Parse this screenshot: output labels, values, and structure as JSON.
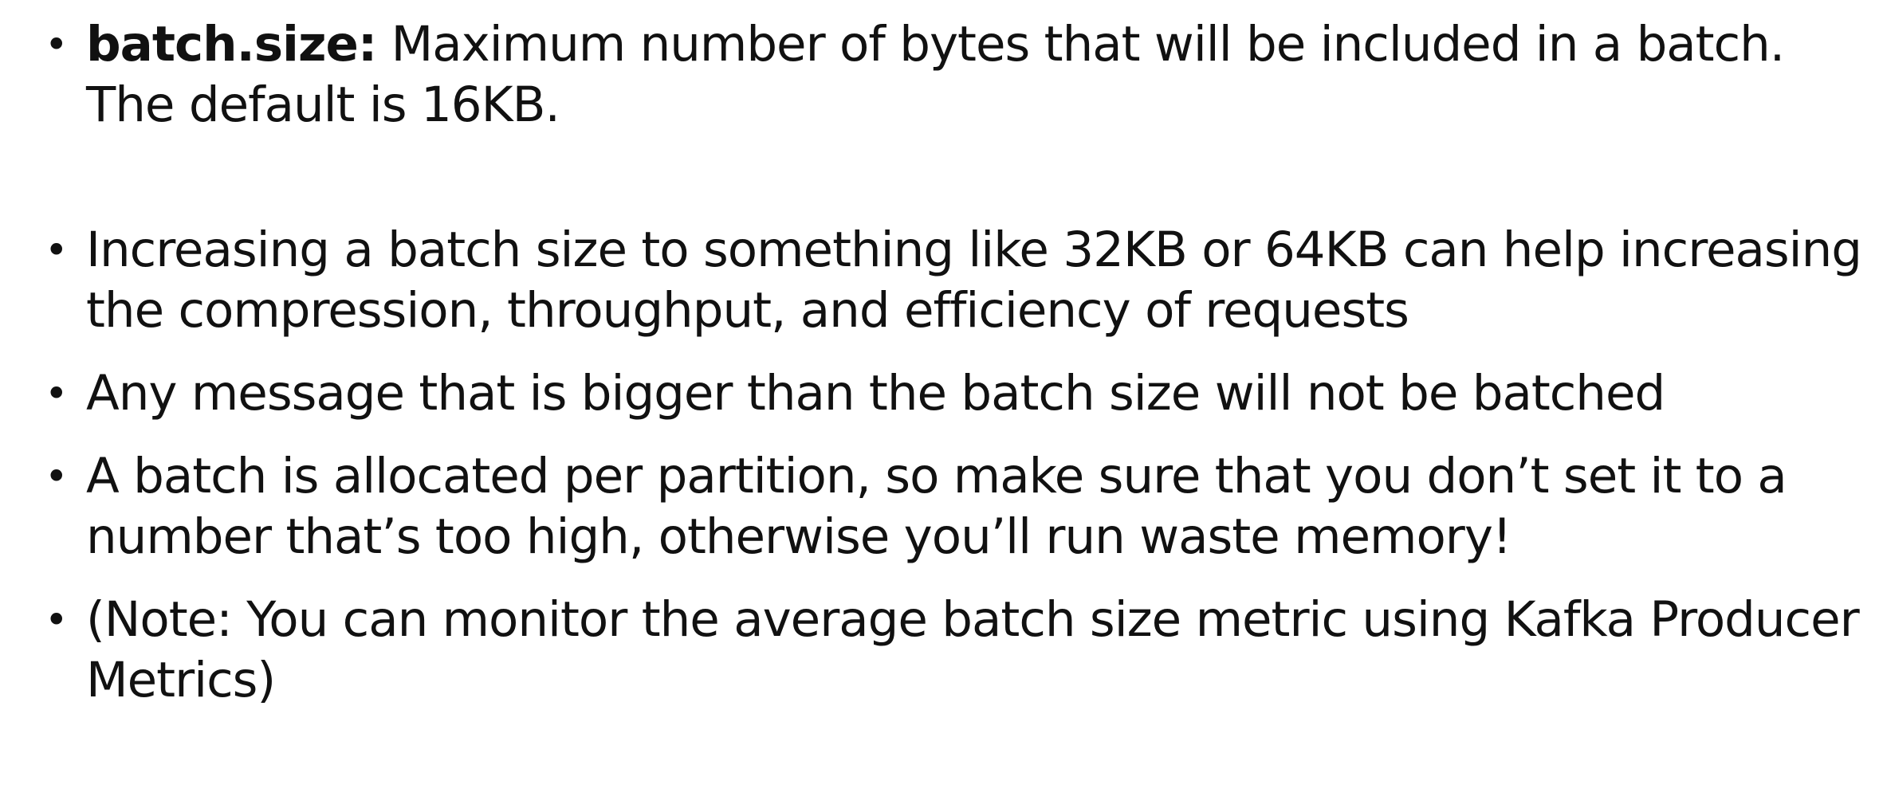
{
  "bullet_symbol": "•",
  "bullets": [
    {
      "term": "batch.size:",
      "text": " Maximum number of bytes that will be included in a batch.  The default is 16KB."
    },
    {
      "term": "",
      "text": "Increasing a batch size to something like 32KB or 64KB can help increasing the compression, throughput, and efficiency of requests"
    },
    {
      "term": "",
      "text": "Any message that is bigger than the batch size will not be batched"
    },
    {
      "term": "",
      "text": "A batch is allocated per partition, so make sure that you don’t set it to a number that’s too high, otherwise you’ll run waste memory!"
    },
    {
      "term": "",
      "text": "(Note: You can monitor the average batch size metric using Kafka Producer Metrics)"
    }
  ]
}
